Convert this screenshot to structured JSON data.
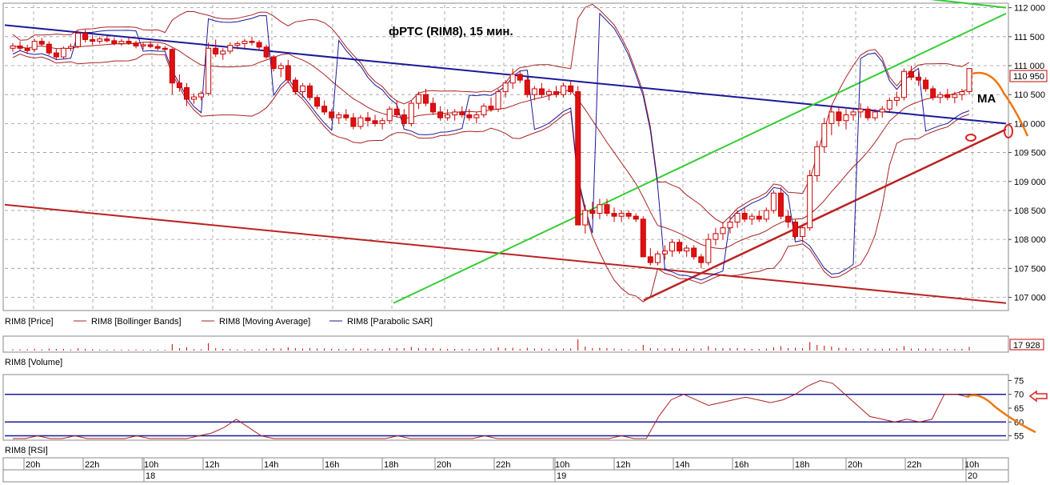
{
  "chart_data": {
    "type": "candlestick",
    "title": "фРТС (RIM8), 15 мин.",
    "annotation": "MA",
    "price_axis": {
      "min": 106800,
      "max": 112050,
      "ticks": [
        "112 000",
        "111 500",
        "111 000",
        "110 500",
        "110 000",
        "109 500",
        "109 000",
        "108 500",
        "108 000",
        "107 500",
        "107 000"
      ],
      "tick_values": [
        112000,
        111500,
        111000,
        110500,
        110000,
        109500,
        109000,
        108500,
        108000,
        107500,
        107000
      ]
    },
    "last_price_label": "110 950",
    "last_price_value": 110950,
    "legend": [
      {
        "label": "RIM8 [Price]",
        "color": "#cc0000"
      },
      {
        "label": "RIM8 [Bollinger Bands]",
        "color": "#aa2222"
      },
      {
        "label": "RIM8 [Moving Average]",
        "color": "#aa2222"
      },
      {
        "label": "RIM8 [Parabolic SAR]",
        "color": "#1a1a99"
      }
    ],
    "volume": {
      "label": "RIM8 [Volume]",
      "last_label": "17 928",
      "last_value": 17928
    },
    "rsi": {
      "label": "RIM8 [RSI]",
      "min": 54,
      "max": 76,
      "ticks": [
        "75",
        "70",
        "65",
        "60",
        "55"
      ],
      "tick_values": [
        75,
        70,
        65,
        60,
        55
      ],
      "levels": [
        70,
        60,
        55
      ]
    },
    "time_axis": {
      "hours": [
        "20h",
        "22h",
        "10h",
        "12h",
        "14h",
        "16h",
        "18h",
        "20h",
        "22h",
        "10h",
        "12h",
        "14h",
        "16h",
        "18h",
        "20h",
        "22h",
        "10h"
      ],
      "days": [
        "18",
        "19",
        "20"
      ]
    },
    "candles": [
      [
        111300,
        111390,
        111240,
        111340
      ],
      [
        111340,
        111420,
        111260,
        111300
      ],
      [
        111300,
        111360,
        111200,
        111260
      ],
      [
        111280,
        111460,
        111240,
        111420
      ],
      [
        111420,
        111480,
        111340,
        111370
      ],
      [
        111370,
        111420,
        111180,
        111220
      ],
      [
        111220,
        111300,
        111100,
        111150
      ],
      [
        111150,
        111330,
        111120,
        111300
      ],
      [
        111300,
        111380,
        111250,
        111330
      ],
      [
        111330,
        111600,
        111300,
        111560
      ],
      [
        111560,
        111620,
        111400,
        111450
      ],
      [
        111450,
        111530,
        111360,
        111420
      ],
      [
        111420,
        111500,
        111380,
        111460
      ],
      [
        111460,
        111520,
        111400,
        111430
      ],
      [
        111430,
        111480,
        111350,
        111380
      ],
      [
        111380,
        111460,
        111340,
        111420
      ],
      [
        111420,
        111480,
        111360,
        111390
      ],
      [
        111390,
        111430,
        111300,
        111340
      ],
      [
        111340,
        111400,
        111280,
        111360
      ],
      [
        111360,
        111420,
        111300,
        111330
      ],
      [
        111330,
        111380,
        111260,
        111300
      ],
      [
        111300,
        111340,
        111250,
        111280
      ],
      [
        111280,
        111300,
        110500,
        110700
      ],
      [
        110700,
        110850,
        110550,
        110620
      ],
      [
        110620,
        110700,
        110300,
        110420
      ],
      [
        110420,
        110520,
        110340,
        110460
      ],
      [
        110460,
        110560,
        110400,
        110520
      ],
      [
        110520,
        111400,
        110480,
        111300
      ],
      [
        111300,
        111450,
        111150,
        111200
      ],
      [
        111200,
        111300,
        111100,
        111250
      ],
      [
        111250,
        111400,
        111200,
        111350
      ],
      [
        111350,
        111420,
        111280,
        111380
      ],
      [
        111380,
        111460,
        111300,
        111420
      ],
      [
        111420,
        111500,
        111350,
        111400
      ],
      [
        111400,
        111440,
        111280,
        111320
      ],
      [
        111320,
        111360,
        111120,
        111150
      ],
      [
        111150,
        111180,
        110900,
        110950
      ],
      [
        110950,
        111050,
        110800,
        111000
      ],
      [
        111000,
        111100,
        110700,
        110750
      ],
      [
        110750,
        110800,
        110500,
        110550
      ],
      [
        110550,
        110700,
        110450,
        110650
      ],
      [
        110650,
        110700,
        110400,
        110450
      ],
      [
        110450,
        110500,
        110250,
        110300
      ],
      [
        110300,
        110400,
        110150,
        110200
      ],
      [
        110200,
        110250,
        110050,
        110100
      ],
      [
        110100,
        110200,
        110000,
        110150
      ],
      [
        110150,
        110250,
        110050,
        110100
      ],
      [
        110100,
        110180,
        109900,
        109950
      ],
      [
        109950,
        110150,
        109900,
        110100
      ],
      [
        110100,
        110200,
        109950,
        110050
      ],
      [
        110050,
        110150,
        109950,
        110000
      ],
      [
        110000,
        110100,
        109900,
        110050
      ],
      [
        110050,
        110300,
        110000,
        110250
      ],
      [
        110250,
        110400,
        110100,
        110150
      ],
      [
        110150,
        110250,
        109950,
        110000
      ],
      [
        110000,
        110400,
        109950,
        110350
      ],
      [
        110350,
        110550,
        110250,
        110500
      ],
      [
        110500,
        110600,
        110300,
        110350
      ],
      [
        110350,
        110450,
        110150,
        110200
      ],
      [
        110200,
        110300,
        110050,
        110100
      ],
      [
        110100,
        110250,
        110050,
        110150
      ],
      [
        110150,
        110250,
        110050,
        110200
      ],
      [
        110200,
        110300,
        110100,
        110150
      ],
      [
        110150,
        110250,
        110050,
        110100
      ],
      [
        110100,
        110200,
        110000,
        110150
      ],
      [
        110150,
        110350,
        110100,
        110300
      ],
      [
        110300,
        110450,
        110200,
        110250
      ],
      [
        110250,
        110600,
        110200,
        110550
      ],
      [
        110550,
        110750,
        110450,
        110700
      ],
      [
        110700,
        110950,
        110600,
        110850
      ],
      [
        110850,
        110900,
        110700,
        110750
      ],
      [
        110750,
        110800,
        110450,
        110500
      ],
      [
        110500,
        110650,
        110400,
        110600
      ],
      [
        110600,
        110700,
        110450,
        110500
      ],
      [
        110500,
        110600,
        110400,
        110550
      ],
      [
        110550,
        110650,
        110450,
        110500
      ],
      [
        110500,
        110700,
        110450,
        110650
      ],
      [
        110650,
        110750,
        110500,
        110550
      ],
      [
        110550,
        110650,
        108250,
        108250
      ],
      [
        108250,
        108600,
        108100,
        108500
      ],
      [
        108500,
        108650,
        108350,
        108450
      ],
      [
        108450,
        108700,
        108350,
        108600
      ],
      [
        108600,
        108700,
        108400,
        108450
      ],
      [
        108450,
        108550,
        108300,
        108400
      ],
      [
        108400,
        108500,
        108300,
        108450
      ],
      [
        108450,
        108500,
        108350,
        108400
      ],
      [
        108400,
        108450,
        108300,
        108350
      ],
      [
        108350,
        108400,
        107700,
        107700
      ],
      [
        107700,
        107850,
        107550,
        107600
      ],
      [
        107600,
        107800,
        107550,
        107750
      ],
      [
        107750,
        107900,
        107650,
        107800
      ],
      [
        107800,
        108000,
        107700,
        107950
      ],
      [
        107950,
        108000,
        107750,
        107800
      ],
      [
        107800,
        107900,
        107700,
        107850
      ],
      [
        107850,
        107900,
        107650,
        107700
      ],
      [
        107700,
        107750,
        107500,
        107600
      ],
      [
        107600,
        108100,
        107550,
        108000
      ],
      [
        108000,
        108200,
        107900,
        108100
      ],
      [
        108100,
        108300,
        108000,
        108200
      ],
      [
        108200,
        108400,
        108100,
        108300
      ],
      [
        108300,
        108500,
        108200,
        108450
      ],
      [
        108450,
        108550,
        108300,
        108350
      ],
      [
        108350,
        108450,
        108250,
        108400
      ],
      [
        108400,
        108500,
        108300,
        108350
      ],
      [
        108350,
        108550,
        108300,
        108500
      ],
      [
        108500,
        108850,
        108450,
        108800
      ],
      [
        108800,
        108900,
        108350,
        108400
      ],
      [
        108400,
        108500,
        108200,
        108300
      ],
      [
        108300,
        108350,
        108000,
        108050
      ],
      [
        108050,
        108250,
        107950,
        108200
      ],
      [
        108200,
        109200,
        108150,
        109100
      ],
      [
        109100,
        109700,
        109000,
        109600
      ],
      [
        109600,
        110100,
        109500,
        110000
      ],
      [
        110000,
        110300,
        109800,
        110200
      ],
      [
        110200,
        110300,
        109950,
        110050
      ],
      [
        110050,
        110250,
        109900,
        110150
      ],
      [
        110150,
        110250,
        110050,
        110200
      ],
      [
        110200,
        110350,
        110100,
        110250
      ],
      [
        110250,
        110300,
        110050,
        110100
      ],
      [
        110100,
        110250,
        110050,
        110200
      ],
      [
        110200,
        110300,
        110100,
        110250
      ],
      [
        110250,
        110450,
        110200,
        110400
      ],
      [
        110400,
        110550,
        110300,
        110450
      ],
      [
        110450,
        110950,
        110400,
        110900
      ],
      [
        110900,
        111000,
        110750,
        110800
      ],
      [
        110800,
        110900,
        110650,
        110750
      ],
      [
        110750,
        110800,
        110550,
        110600
      ],
      [
        110600,
        110650,
        110400,
        110450
      ],
      [
        110450,
        110550,
        110350,
        110500
      ],
      [
        110500,
        110600,
        110400,
        110450
      ],
      [
        110450,
        110550,
        110350,
        110500
      ],
      [
        110500,
        110600,
        110400,
        110550
      ],
      [
        110550,
        110950,
        110500,
        110950
      ]
    ],
    "lines": {
      "upper_blue": {
        "color": "#1a1a99",
        "from": 111700,
        "to": 110000
      },
      "lower_red": {
        "color": "#bb2222",
        "from": 108600,
        "to": 106900
      },
      "rising_red": {
        "color": "#bb2222",
        "from": 106950,
        "to": 109900
      },
      "rising_green": {
        "color": "#33cc33",
        "from": 106900,
        "to": 111900
      },
      "top_green": {
        "color": "#33cc33",
        "from": 112200,
        "to": 112000
      }
    },
    "rsi_series": [
      54,
      54,
      55,
      54,
      54,
      55,
      54,
      54,
      54,
      54,
      55,
      54,
      54,
      54,
      54,
      55,
      56,
      58,
      61,
      58,
      55,
      54,
      54,
      54,
      54,
      54,
      54,
      54,
      54,
      54,
      54,
      55,
      54,
      54,
      54,
      54,
      54,
      54,
      55,
      54,
      54,
      54,
      54,
      54,
      54,
      54,
      54,
      54,
      54,
      55,
      54,
      54,
      62,
      68,
      70,
      68,
      66,
      67,
      68,
      69,
      68,
      67,
      68,
      70,
      73,
      75,
      74,
      70,
      66,
      62,
      61,
      60,
      61,
      60,
      61,
      70,
      70,
      69
    ]
  }
}
